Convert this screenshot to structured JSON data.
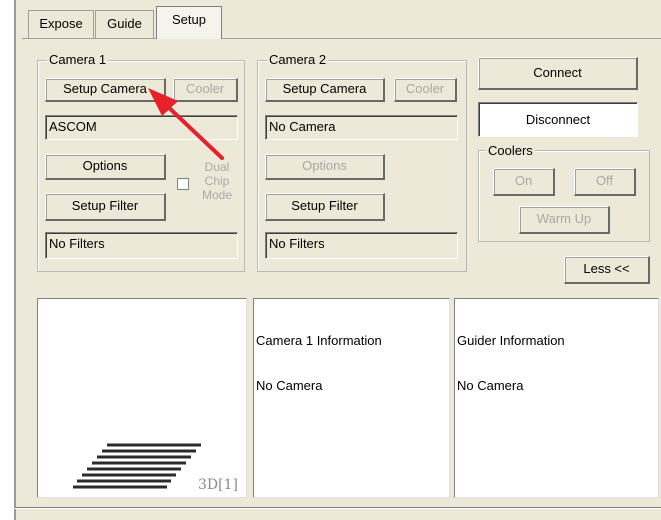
{
  "tabs": [
    {
      "label": "Expose"
    },
    {
      "label": "Guide"
    },
    {
      "label": "Setup",
      "selected": true
    }
  ],
  "camera1": {
    "legend": "Camera 1",
    "setup_camera": "Setup Camera",
    "cooler": "Cooler",
    "driver": "ASCOM",
    "options": "Options",
    "dual_chip": [
      "Dual",
      "Chip",
      "Mode"
    ],
    "setup_filter": "Setup Filter",
    "filter": "No Filters"
  },
  "camera2": {
    "legend": "Camera 2",
    "setup_camera": "Setup Camera",
    "cooler": "Cooler",
    "driver": "No Camera",
    "options": "Options",
    "setup_filter": "Setup Filter",
    "filter": "No Filters"
  },
  "connect": "Connect",
  "disconnect": "Disconnect",
  "coolers": {
    "legend": "Coolers",
    "on": "On",
    "off": "Off",
    "warm_up": "Warm Up"
  },
  "less": "Less <<",
  "preview": {
    "label": "3D[1]"
  },
  "camera1_info": {
    "title": "Camera 1 Information",
    "status": "No Camera"
  },
  "guider_info": {
    "title": "Guider Information",
    "status": "No Camera"
  },
  "annotation": {
    "color": "#e8202a",
    "shape": "arrow"
  }
}
